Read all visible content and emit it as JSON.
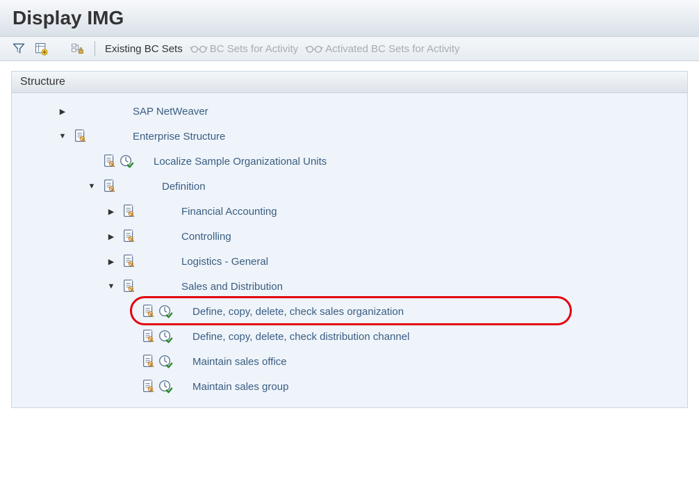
{
  "title": "Display IMG",
  "toolbar": {
    "existing_bc_sets": "Existing BC Sets",
    "bc_sets_for_activity": "BC Sets for Activity",
    "activated_bc_sets_for_activity": "Activated BC Sets for Activity"
  },
  "structure": {
    "header": "Structure",
    "nodes": {
      "sap_netweaver": "SAP NetWeaver",
      "enterprise_structure": "Enterprise Structure",
      "localize_sample": "Localize Sample Organizational Units",
      "definition": "Definition",
      "financial_accounting": "Financial Accounting",
      "controlling": "Controlling",
      "logistics_general": "Logistics - General",
      "sales_distribution": "Sales and Distribution",
      "define_sales_org": "Define, copy, delete, check sales organization",
      "define_dist_channel": "Define, copy, delete, check distribution channel",
      "maintain_sales_office": "Maintain sales office",
      "maintain_sales_group": "Maintain sales group"
    }
  }
}
